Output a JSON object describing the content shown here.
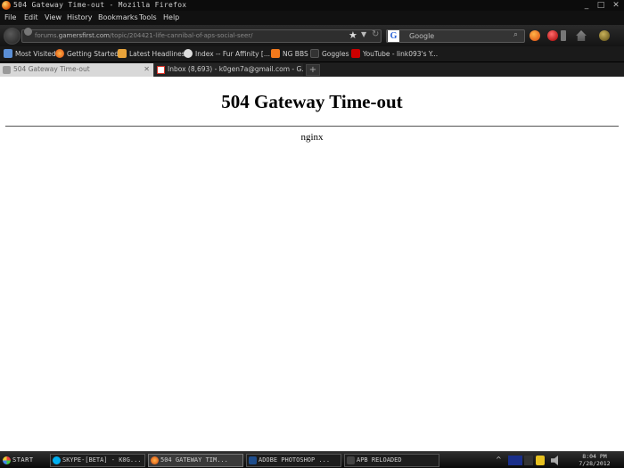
{
  "window": {
    "title": "504 Gateway Time-out - Mozilla Firefox",
    "minimize": "_",
    "maximize": "□",
    "close": "✕"
  },
  "menu": [
    "File",
    "Edit",
    "View",
    "History",
    "Bookmarks",
    "Tools",
    "Help"
  ],
  "nav": {
    "url_prefix": "forums.",
    "url_domain": "gamersfirst.com",
    "url_path": "/topic/204421-life-cannibal-of-aps-social-seer/",
    "star": "★",
    "dropdown": "▼",
    "reload": "↻",
    "search_placeholder": "Google",
    "search_engine": "G",
    "search_icon": "⌕"
  },
  "bookmarks": [
    {
      "label": "Most Visited",
      "icon": "most-visited-icon"
    },
    {
      "label": "Getting Started",
      "icon": "firefox-icon"
    },
    {
      "label": "Latest Headlines",
      "icon": "rss-icon"
    },
    {
      "label": "Index -- Fur Affinity [...",
      "icon": "paw-icon"
    },
    {
      "label": "NG BBS",
      "icon": "newgrounds-icon"
    },
    {
      "label": "Goggles",
      "icon": "goggles-icon"
    },
    {
      "label": "YouTube - link093's Y...",
      "icon": "youtube-icon"
    }
  ],
  "tabs": [
    {
      "label": "504 Gateway Time-out",
      "close": "✕"
    },
    {
      "label": "Inbox (8,693) - k0gen7a@gmail.com - G..."
    }
  ],
  "new_tab": "+",
  "page": {
    "heading": "504 Gateway Time-out",
    "server": "nginx"
  },
  "taskbar": {
    "start": "Start",
    "tasks": [
      {
        "label": "Skype-[Beta] - k0g..."
      },
      {
        "label": "504 Gateway Tim..."
      },
      {
        "label": "Adobe Photoshop ..."
      },
      {
        "label": "APB Reloaded"
      }
    ],
    "tray_arrow": "^",
    "clock_time": "8:04 PM",
    "clock_date": "7/28/2012"
  },
  "colors": {
    "chrome_dark": "#111111",
    "page_bg": "#ffffff",
    "youtube_red": "#cc0000",
    "gmail_red": "#d93025"
  }
}
